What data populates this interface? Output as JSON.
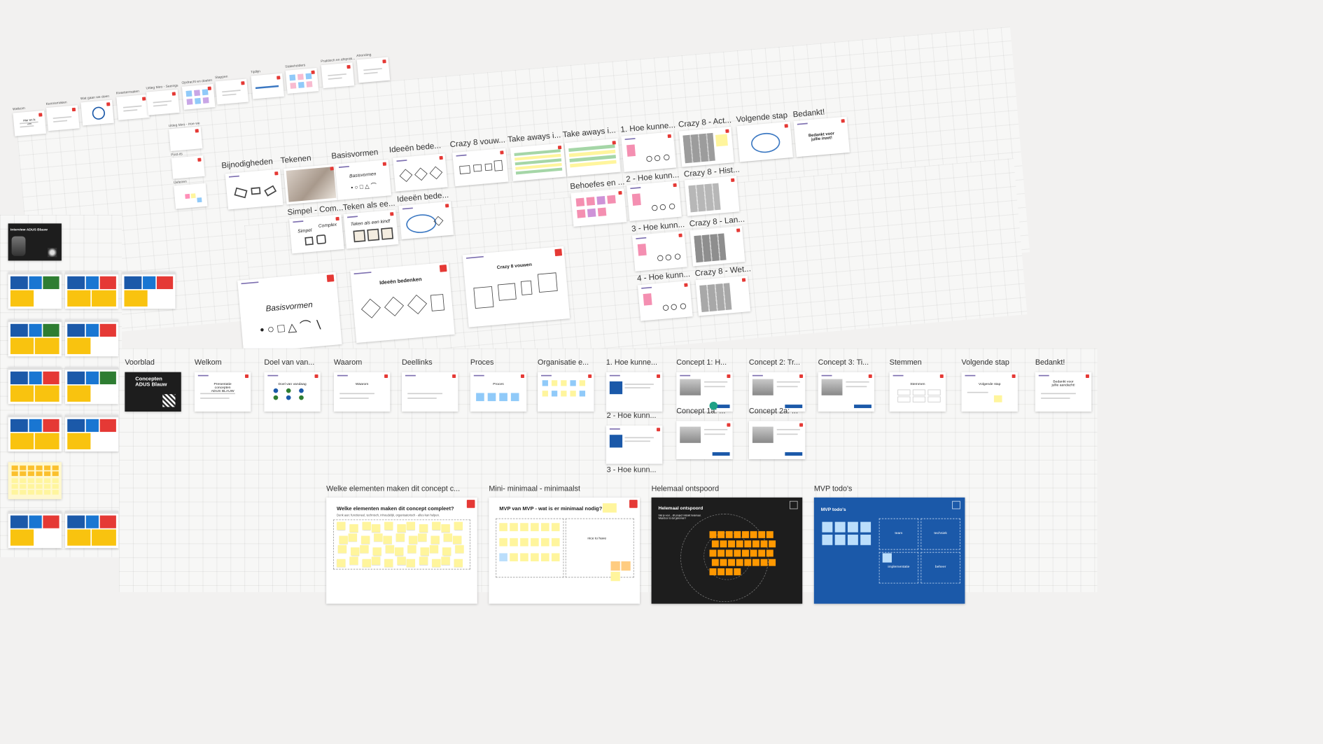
{
  "colors": {
    "canvas": "#f2f1f0",
    "sticky_yellow": "#fff59d",
    "sticky_orange": "#ff9800",
    "sticky_pink": "#f48fb1",
    "sticky_purple": "#ce93d8",
    "accent_red": "#e53935",
    "accent_blue": "#1b59a9",
    "accent_teal": "#1fa187"
  },
  "session1": {
    "small_row": [
      {
        "label": "Welkom",
        "slide": "Hier en ik\nziet"
      },
      {
        "label": "Kennismaken",
        "slide": ""
      },
      {
        "label": "Wat gaan we doen",
        "slide": ""
      },
      {
        "label": "Kwartiermaken",
        "slide": ""
      },
      {
        "label": "Uitleg Miro - Seeings",
        "slide": ""
      },
      {
        "label": "Opdracht en doelen",
        "slide": ""
      },
      {
        "label": "Stappen",
        "slide": ""
      },
      {
        "label": "Tijdlijn",
        "slide": ""
      },
      {
        "label": "Stakeholders",
        "slide": ""
      },
      {
        "label": "Praktisch en afsprak...",
        "slide": ""
      },
      {
        "label": "Afronding",
        "slide": ""
      }
    ],
    "stack_col": [
      {
        "label": "Uitleg Miro - Hoe we"
      },
      {
        "label": "Post-its"
      },
      {
        "label": "Oefenen"
      }
    ],
    "frames": {
      "bijnodigheden": "Bijnodigheden",
      "tekenen": "Tekenen",
      "basisvormen": "Basisvormen",
      "basisvormen_slide": "Basisvormen",
      "simpel_com": "Simpel - Com...",
      "simpel_slide": "Simpel",
      "complex_slide": "Complex",
      "teken_als": "Teken als ee...",
      "teken_slide": "Teken als een kind!",
      "ideeen_bede_1": "Ideeën bede...",
      "ideeen_bede_2": "Ideeën bede...",
      "crazy8_vouw": "Crazy 8 vouw...",
      "take_aways_1": "Take aways i...",
      "take_aways_2": "Take aways i...",
      "behoeftes": "Behoefes en ...",
      "hoe_kunnen_1": "1. Hoe kunne...",
      "hoe_kunnen_2": "2 - Hoe kunn...",
      "hoe_kunnen_3": "3 - Hoe kunn...",
      "hoe_kunnen_4": "4 - Hoe kunn...",
      "crazy8_act": "Crazy 8 - Act...",
      "crazy8_hist": "Crazy 8 - Hist...",
      "crazy8_lan": "Crazy 8 - Lan...",
      "crazy8_wet": "Crazy 8 - Wet...",
      "volgende_stap": "Volgende stap",
      "bedankt": "Bedankt!",
      "bedankt_slide": "Bedankt voor\njullie inzet!"
    },
    "large_slides": {
      "basisvormen": "Basisvormen",
      "ideeen": "Ideeën bedenken",
      "crazy8": "Crazy 8 vouwen"
    }
  },
  "left_column": {
    "interview_title": "Interview ADUS Blauw"
  },
  "session2": {
    "frames": [
      {
        "label": "Voorblad",
        "slide": "Concepten\nADUS Blauw"
      },
      {
        "label": "Welkom",
        "slide": "Presentatie\nconcepten\nADUS BLAUW"
      },
      {
        "label": "Doel van van...",
        "slide": "Doel van vandaag"
      },
      {
        "label": "Waarom",
        "slide": "Waarom"
      },
      {
        "label": "Deellinks",
        "slide": ""
      },
      {
        "label": "Proces",
        "slide": "Proces"
      },
      {
        "label": "Organisatie e...",
        "slide": ""
      },
      {
        "label": "1. Hoe kunne...",
        "slide": ""
      },
      {
        "label": "Concept 1: H...",
        "slide": ""
      },
      {
        "label": "Concept 2: Tr...",
        "slide": ""
      },
      {
        "label": "Concept 3: Ti...",
        "slide": ""
      },
      {
        "label": "Stemmen",
        "slide": "Stemmen"
      },
      {
        "label": "Volgende stap",
        "slide": "Volgende stap"
      },
      {
        "label": "Bedankt!",
        "slide": "Bedankt voor\njullie aandacht!"
      }
    ],
    "second_row": [
      {
        "label": "2 - Hoe kunn..."
      },
      {
        "label": "Concept 1a: ..."
      },
      {
        "label": "Concept 2a: ..."
      }
    ],
    "third_row": [
      {
        "label": "3 - Hoe kunn..."
      }
    ]
  },
  "workshops": [
    {
      "label": "Welke elementen maken dit concept c...",
      "title": "Welke elementen maken dit concept compleet?",
      "subtitle": "Denk aan: functioneel, technisch, inhoudelijk, organisatorisch - alles kan helpen."
    },
    {
      "label": "Mini- minimaal - minimaalst",
      "title": "MVP van MVP - wat is er minimaal nodig?",
      "nice_to_have": "nice to have"
    },
    {
      "label": "Helemaal ontspoord",
      "title": "Helemaal ontspoord",
      "body": "Stel je voor... dit project mislukt helemaal. Waardoor is dat gekomen?"
    },
    {
      "label": "MVP todo's",
      "title": "MVP todo's",
      "cells": [
        "team",
        "techniek",
        "implementatie",
        "beheer"
      ]
    }
  ]
}
